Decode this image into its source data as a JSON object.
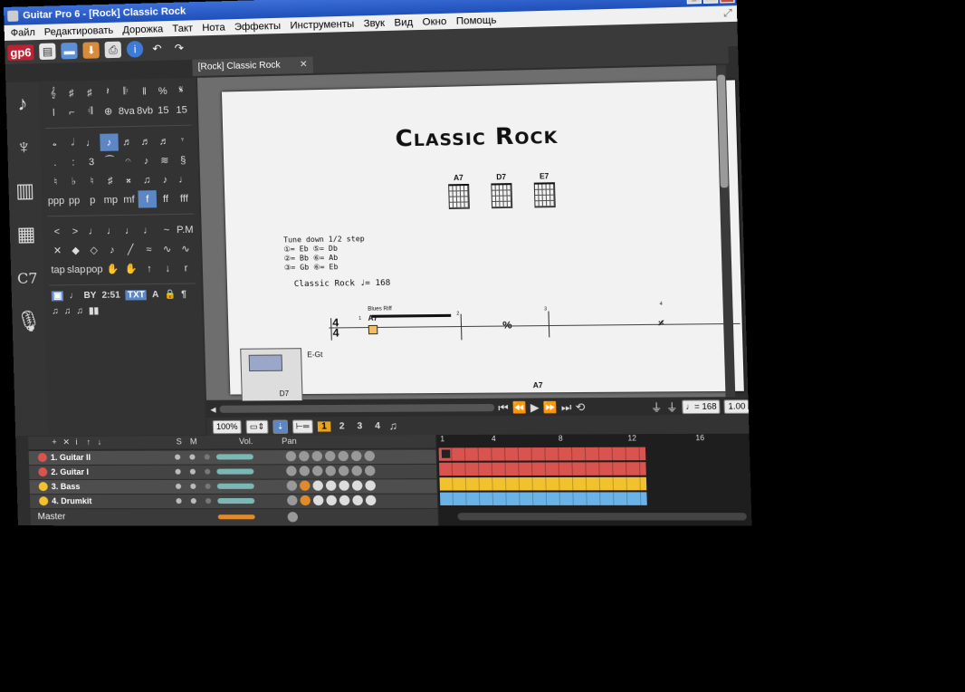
{
  "window": {
    "title": "Guitar Pro 6 - [Rock] Classic Rock"
  },
  "menu": [
    "Файл",
    "Редактировать",
    "Дорожка",
    "Такт",
    "Нота",
    "Эффекты",
    "Инструменты",
    "Звук",
    "Вид",
    "Окно",
    "Помощь"
  ],
  "toolbar": {
    "logo": "gp6"
  },
  "tab": {
    "label": "[Rock] Classic Rock",
    "close": "✕"
  },
  "score": {
    "title": "Classic Rock",
    "chords": [
      "A7",
      "D7",
      "E7"
    ],
    "tuning": [
      "Tune down 1/2 step",
      "①= Eb  ⑤= Db",
      "②= Bb  ⑥= Ab",
      "③= Gb  ⑥= Eb"
    ],
    "tempo_text": "Classic Rock  ♩= 168",
    "riff": "Blues Riff",
    "chord_label": "A7",
    "chord_label_bottom": "A7",
    "track_short": "E-Gt",
    "thumb_chord": "D7",
    "measures": [
      "1",
      "2",
      "3",
      "4"
    ]
  },
  "controls": {
    "zoom": "100%",
    "numbers": [
      "1",
      "2",
      "3",
      "4"
    ],
    "tempo": "♩= 168",
    "speed": "1.00"
  },
  "mixer": {
    "headers": {
      "s": "S",
      "m": "M",
      "vol": "Vol.",
      "pan": "Pan"
    },
    "tracks": [
      {
        "name": "1. Guitar II",
        "color": "#d9534f"
      },
      {
        "name": "2. Guitar I",
        "color": "#d9534f"
      },
      {
        "name": "3. Bass",
        "color": "#f2c12e"
      },
      {
        "name": "4. Drumkit",
        "color": "#f2c12e"
      }
    ],
    "master": "Master",
    "timeline": [
      "1",
      "4",
      "8",
      "12",
      "16"
    ]
  }
}
